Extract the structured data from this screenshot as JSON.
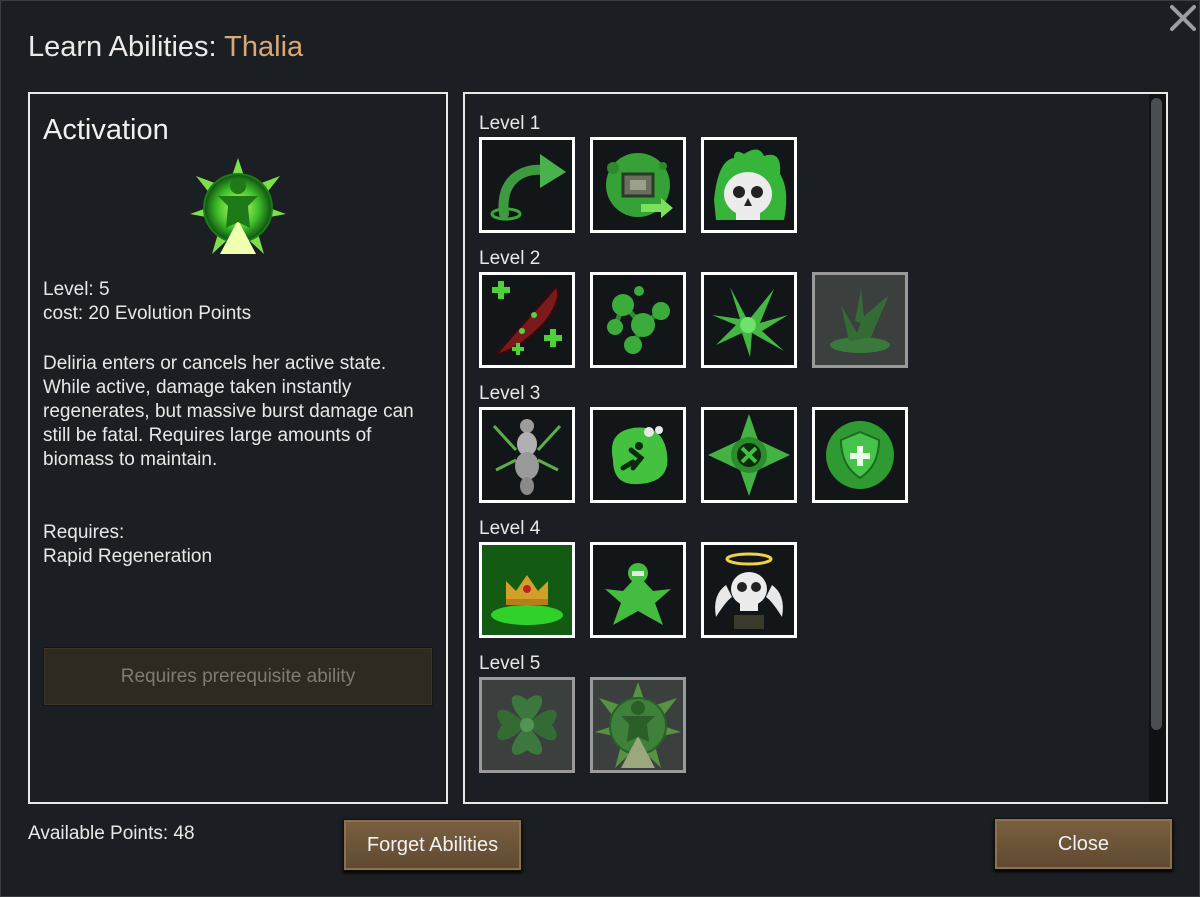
{
  "dialog": {
    "title_prefix": "Learn Abilities: ",
    "character_name": "Thalia",
    "accent_color": "#d8a875"
  },
  "detail": {
    "ability_name": "Activation",
    "icon": "activation-icon",
    "level_line": "Level: 5",
    "cost_line": "cost: 20 Evolution Points",
    "description": "Deliria enters or cancels her active state. While active, damage taken instantly regenerates, but massive burst damage can still be fatal. Requires large amounts of biomass to maintain.",
    "requires_label": "Requires:",
    "requires_value": "Rapid Regeneration",
    "action_button": "Requires prerequisite ability"
  },
  "levels": [
    {
      "label": "Level 1",
      "abilities": [
        {
          "icon": "curved-arrow-icon",
          "available": true
        },
        {
          "icon": "green-monitor-icon",
          "available": true
        },
        {
          "icon": "toxic-skull-icon",
          "available": true
        }
      ]
    },
    {
      "label": "Level 2",
      "abilities": [
        {
          "icon": "red-tendril-heal-icon",
          "available": true
        },
        {
          "icon": "green-cells-icon",
          "available": true
        },
        {
          "icon": "green-spikes-icon",
          "available": true
        },
        {
          "icon": "ground-burst-icon",
          "available": false
        }
      ]
    },
    {
      "label": "Level 3",
      "abilities": [
        {
          "icon": "insect-body-icon",
          "available": true
        },
        {
          "icon": "slime-figure-icon",
          "available": true
        },
        {
          "icon": "spiked-orb-icon",
          "available": true
        },
        {
          "icon": "shield-plus-icon",
          "available": true
        }
      ]
    },
    {
      "label": "Level 4",
      "abilities": [
        {
          "icon": "crown-altar-icon",
          "available": true
        },
        {
          "icon": "green-mutant-icon",
          "available": true
        },
        {
          "icon": "haloed-skull-icon",
          "available": true
        }
      ]
    },
    {
      "label": "Level 5",
      "abilities": [
        {
          "icon": "green-vortex-icon",
          "available": false
        },
        {
          "icon": "activation-icon",
          "available": false
        }
      ]
    }
  ],
  "footer": {
    "available_points": "Available Points: 48",
    "forget_button": "Forget Abilities",
    "close_button": "Close"
  }
}
